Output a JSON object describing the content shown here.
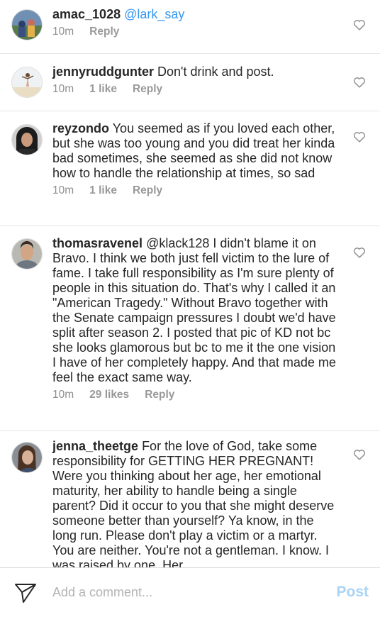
{
  "comments": [
    {
      "username": "amac_1028",
      "text": "@lark_say",
      "time": "10m",
      "likes": "",
      "reply": "Reply"
    },
    {
      "username": "jennyruddgunter",
      "text": "Don't drink and post.",
      "time": "10m",
      "likes": "1 like",
      "reply": "Reply"
    },
    {
      "username": "reyzondo",
      "text": "You seemed as if you loved each other, but she was too young and you did treat her kinda bad sometimes, she seemed as she did not know how to handle the relationship at times, so sad",
      "time": "10m",
      "likes": "1 like",
      "reply": "Reply"
    },
    {
      "username": "thomasravenel",
      "text": "@klack128 I didn't blame it on Bravo. I think we both just fell victim to the lure of fame. I take full responsibility as I'm sure plenty of people in this situation do.  That's why I called it an \"American Tragedy.\" Without Bravo together with the Senate campaign pressures I doubt we'd have split after season 2. I posted that pic of KD not bc she looks glamorous but bc to me it the one vision I have of her completely happy. And that made me feel the exact same way.",
      "time": "10m",
      "likes": "29 likes",
      "reply": "Reply"
    },
    {
      "username": "jenna_theetge",
      "text": "For the love of God, take some responsibility for GETTING HER PREGNANT! Were you thinking about her age, her emotional maturity, her ability to handle being a single parent? Did it occur to you that she might deserve someone better than yourself? Ya know, in the long run. Please don't play a victim or a martyr. You are neither. You're not a gentleman. I know. I was raised by one. Her",
      "time": "",
      "likes": "",
      "reply": ""
    }
  ],
  "composer": {
    "placeholder": "Add a comment...",
    "post_label": "Post"
  },
  "colors": {
    "link_blue": "#3897f0",
    "post_disabled": "#a9d4f5",
    "meta_gray": "#8e8e8e"
  },
  "icons": {
    "like": "heart-outline-icon",
    "send": "paper-plane-icon"
  }
}
